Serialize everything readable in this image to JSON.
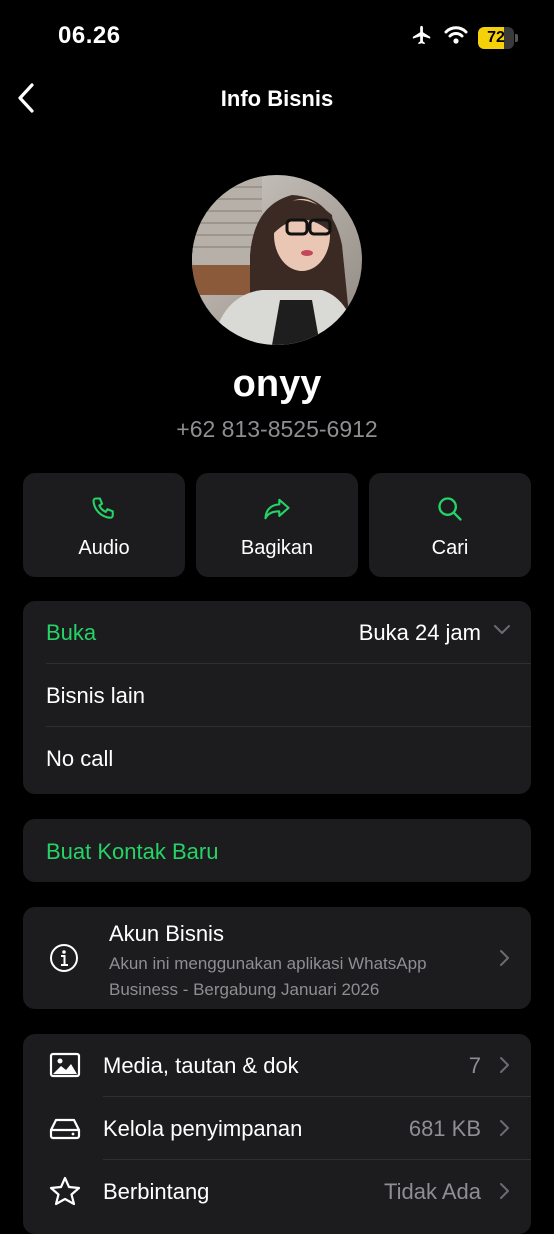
{
  "status_bar": {
    "time": "06.26",
    "battery_level": "72",
    "battery_fraction": 0.72
  },
  "nav": {
    "title": "Info Bisnis"
  },
  "profile": {
    "name": "onyy",
    "phone": "+62 813-8525-6912"
  },
  "actions": [
    {
      "label": "Audio",
      "icon": "phone-icon"
    },
    {
      "label": "Bagikan",
      "icon": "share-icon"
    },
    {
      "label": "Cari",
      "icon": "search-icon"
    }
  ],
  "hours_card": {
    "status_label": "Buka",
    "hours_value": "Buka 24 jam",
    "category": "Bisnis lain",
    "note": "No call"
  },
  "create_contact": {
    "label": "Buat Kontak Baru"
  },
  "business_account": {
    "title": "Akun Bisnis",
    "description": "Akun ini menggunakan aplikasi WhatsApp Business - Bergabung Januari 2026"
  },
  "media_list": [
    {
      "label": "Media, tautan & dok",
      "value": "7",
      "icon": "image-icon"
    },
    {
      "label": "Kelola penyimpanan",
      "value": "681 KB",
      "icon": "storage-icon"
    },
    {
      "label": "Berbintang",
      "value": "Tidak Ada",
      "icon": "star-icon"
    }
  ],
  "colors": {
    "accent": "#25d366",
    "background": "#000000",
    "card": "#1c1c1e",
    "secondary_text": "#8e8e93",
    "battery": "#f5d10a"
  }
}
